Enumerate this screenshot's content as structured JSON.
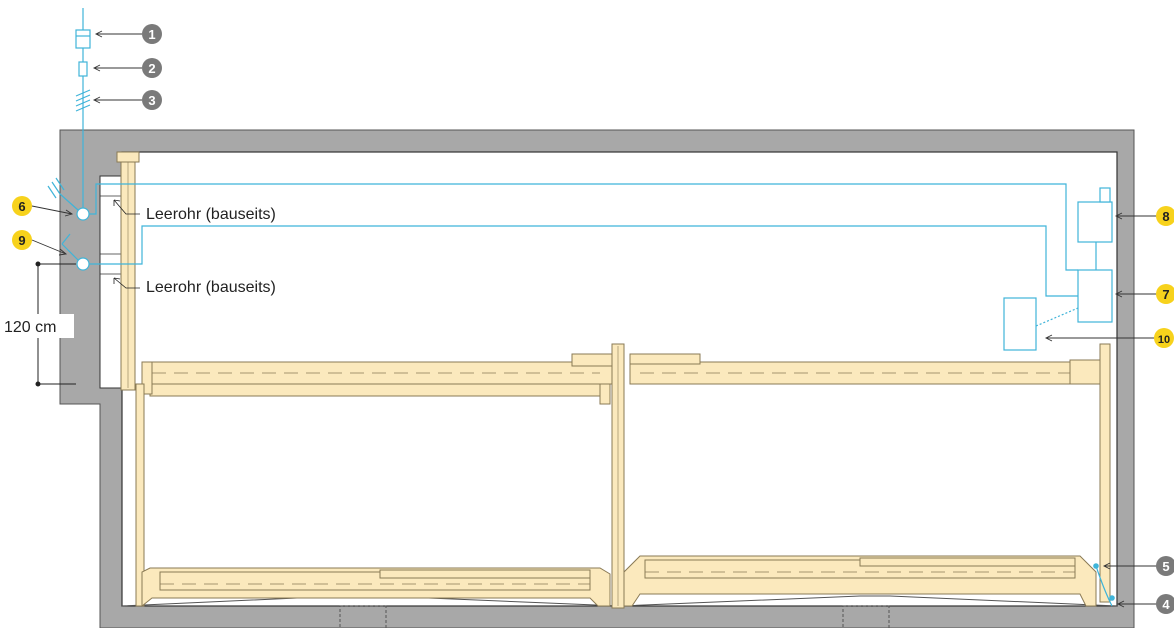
{
  "labels": {
    "leerohr_top": "Leerohr (bauseits)",
    "leerohr_bottom": "Leerohr (bauseits)",
    "dimension": "120 cm"
  },
  "markers": [
    {
      "id": "1",
      "style": "gray"
    },
    {
      "id": "2",
      "style": "gray"
    },
    {
      "id": "3",
      "style": "gray"
    },
    {
      "id": "4",
      "style": "gray"
    },
    {
      "id": "5",
      "style": "gray"
    },
    {
      "id": "6",
      "style": "yellow"
    },
    {
      "id": "7",
      "style": "yellow"
    },
    {
      "id": "8",
      "style": "yellow"
    },
    {
      "id": "9",
      "style": "yellow"
    },
    {
      "id": "10",
      "style": "yellow"
    }
  ],
  "colors": {
    "wall": "#a8a8a8",
    "wall_stroke": "#555555",
    "wood": "#fbe9bd",
    "wood_stroke": "#8a7a55",
    "cable": "#3fb4d9",
    "marker_gray": "#7a7a7a",
    "marker_yellow": "#f7d21c"
  }
}
